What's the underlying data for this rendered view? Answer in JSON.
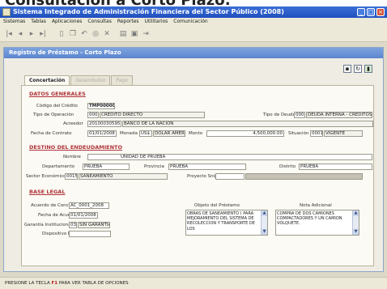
{
  "caption_text": "Consultación a Corto Plazo:",
  "app_title": "Sistema Integrado de Administración Financiera del Sector Público (2008)",
  "menu": [
    "Sistemas",
    "Tablas",
    "Aplicaciones",
    "Consultas",
    "Reportes",
    "Utilitarios",
    "Comunicación"
  ],
  "toolbar_icons": [
    "first-record-icon",
    "previous-record-icon",
    "next-record-icon",
    "last-record-icon",
    "new-document-icon",
    "copy-icon",
    "undo-icon",
    "print-preview-icon",
    "delete-icon",
    "print-icon",
    "save-icon",
    "exit-icon"
  ],
  "window": {
    "title": "Registro de Préstamo - Corto Plazo"
  },
  "tabs": [
    {
      "label": "Concertación",
      "active": true
    },
    {
      "label": "Desembolso",
      "active": false
    },
    {
      "label": "Pago",
      "active": false
    }
  ],
  "datos_generales": {
    "title": "DATOS GENERALES",
    "codigo_label": "Código del Crédito",
    "codigo_value": "TMP00000",
    "tipo_operacion_label": "Tipo de Operación",
    "tipo_operacion_code": "0001",
    "tipo_operacion_desc": "CRÉDITO DIRECTO",
    "tipo_deuda_label": "Tipo de Deuda",
    "tipo_deuda_code": "0002",
    "tipo_deuda_desc": "DEUDA INTERNA - CRÉDITOS",
    "acreedor_label": "Acreedor",
    "acreedor_code": "20100030595",
    "acreedor_desc": "BANCO DE LA NACION",
    "fecha_contrato_label": "Fecha de Contrato",
    "fecha_contrato_value": "01/01/2008",
    "moneda_label": "Moneda",
    "moneda_code": "US$",
    "moneda_desc": "DÓLAR AMERIC",
    "monto_label": "Monto",
    "monto_value": "4,500,000.00",
    "situacion_label": "Situación",
    "situacion_code": "0001",
    "situacion_desc": "VIGENTE"
  },
  "destino": {
    "title": "DESTINO DEL ENDEUDAMIENTO",
    "nombre_label": "Nombre",
    "nombre_value": "UNIDAD DE PRUEBA",
    "departamento_label": "Departamento",
    "departamento_value": "PRUEBA",
    "provincia_label": "Provincia",
    "provincia_value": "PRUEBA",
    "distrito_label": "Distrito",
    "distrito_value": "PRUEBA",
    "sector_label": "Sector Económico",
    "sector_code": "0015",
    "sector_desc": "SANEAMIENTO",
    "proyecto_label": "Proyecto Snip"
  },
  "base_legal": {
    "title": "BASE LEGAL",
    "acuerdo_label": "Acuerdo de Concejo",
    "acuerdo_value": "AC_0001_2008",
    "fecha_acuerdo_label": "Fecha de Acuerdo",
    "fecha_acuerdo_value": "01/01/2008",
    "garantia_label": "Garantía Institucional",
    "garantia_code": "03",
    "garantia_desc": "SIN GARANTIA",
    "dispositivo_label": "Dispositivo Legal",
    "objeto_label": "Objeto del Préstamo",
    "objeto_value": "OBRAS DE SANEAMIENTO ( PARA MEJORAMIENTO DEL SISTEMA DE RECOLECCION Y TRANSPORTE DE LOS",
    "nota_label": "Nota Adicional",
    "nota_value": "COMPRA DE DOS CAMIONES COMPACTADORES Y UN CAMION VOLQUETE."
  },
  "status": {
    "before": "PRESIONE LA TECLA",
    "key": "F1",
    "after": "PARA VER TABLA DE OPCIONES"
  }
}
